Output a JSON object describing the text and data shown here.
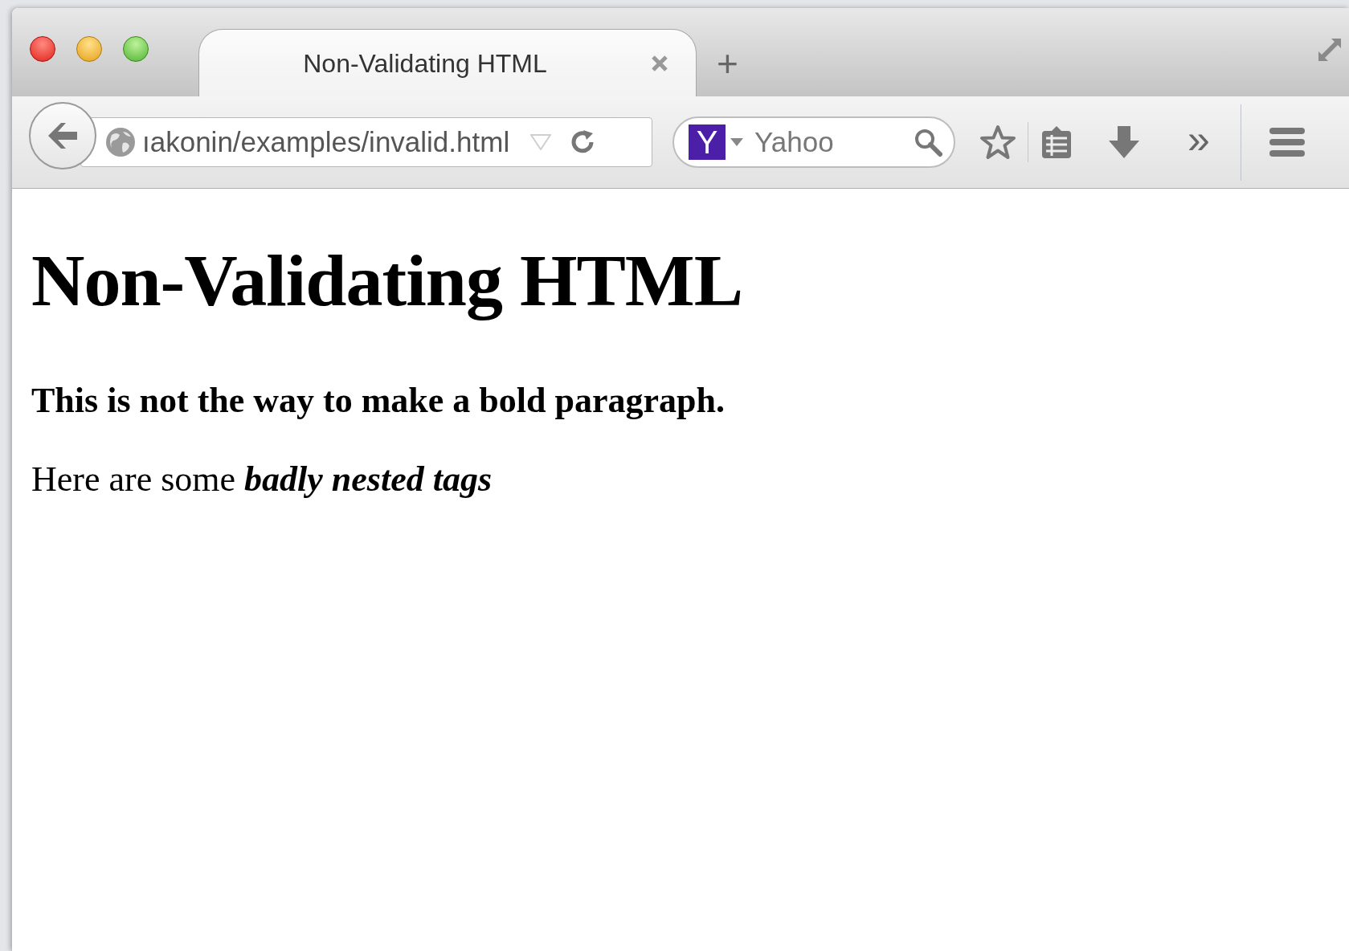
{
  "tabs": [
    {
      "title": "Non-Validating HTML",
      "selected": true
    }
  ],
  "new_tab": "+",
  "url_field": {
    "value": "ıakonin/examples/invalid.html"
  },
  "search_field": {
    "engine_logo": "Y",
    "placeholder": "Yahoo"
  },
  "overflow_button": "»",
  "page": {
    "heading": "Non-Validating HTML",
    "bold_paragraph": "This is not the way to make a bold paragraph.",
    "paragraph": "Here are some *badly nested tags*"
  }
}
